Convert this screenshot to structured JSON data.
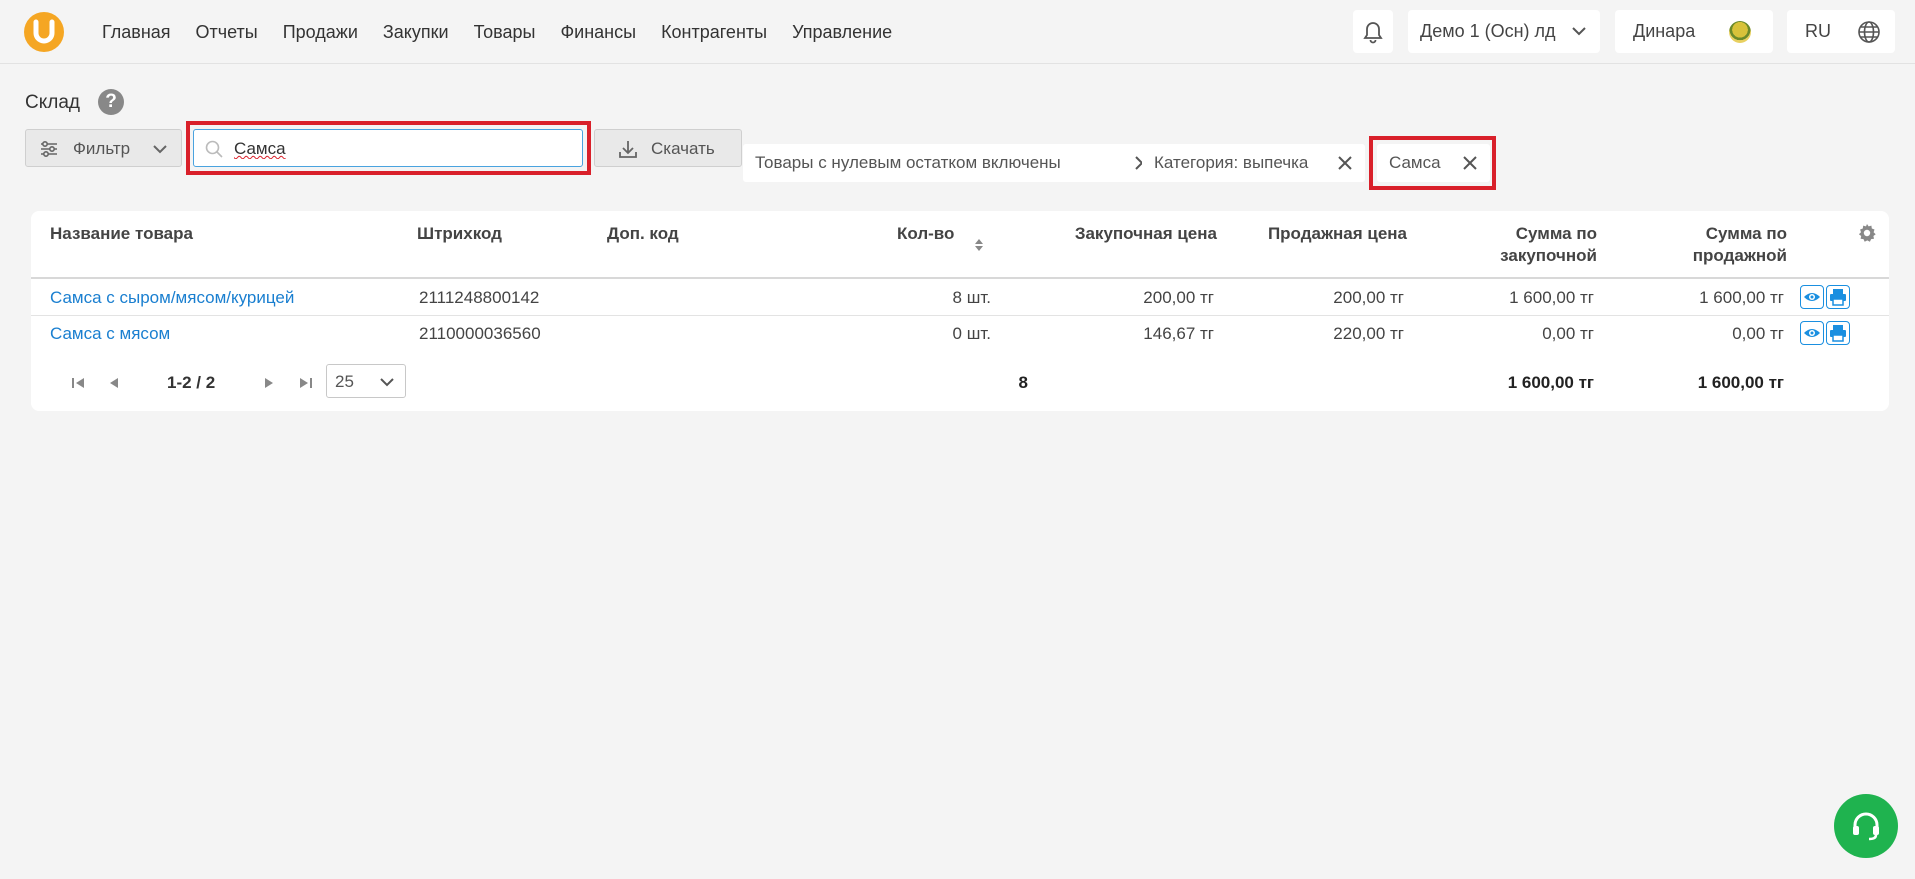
{
  "nav": {
    "items": [
      "Главная",
      "Отчеты",
      "Продажи",
      "Закупки",
      "Товары",
      "Финансы",
      "Контрагенты",
      "Управление"
    ]
  },
  "topbar": {
    "org": "Демо 1 (Осн) лд",
    "user": "Динара",
    "lang": "RU"
  },
  "page": {
    "title": "Склад"
  },
  "toolbar": {
    "filter_label": "Фильтр",
    "search_value": "Самса",
    "download_label": "Скачать"
  },
  "chips": [
    {
      "label": "Товары с нулевым остатком включены"
    },
    {
      "label": "Категория: выпечка"
    },
    {
      "label": "Самса"
    }
  ],
  "table": {
    "headers": {
      "name": "Название товара",
      "barcode": "Штрихкод",
      "extra_code": "Доп. код",
      "qty": "Кол-во",
      "purchase_price": "Закупочная цена",
      "sale_price": "Продажная цена",
      "sum_purchase_1": "Сумма по",
      "sum_purchase_2": "закупочной",
      "sum_sale_1": "Сумма по",
      "sum_sale_2": "продажной"
    },
    "rows": [
      {
        "name": "Самса с сыром/мясом/курицей",
        "barcode": "2111248800142",
        "extra_code": "",
        "qty": "8 шт.",
        "purchase_price": "200,00 тг",
        "sale_price": "200,00 тг",
        "sum_purchase": "1 600,00 тг",
        "sum_sale": "1 600,00 тг"
      },
      {
        "name": "Самса с мясом",
        "barcode": "2110000036560",
        "extra_code": "",
        "qty": "0 шт.",
        "purchase_price": "146,67 тг",
        "sale_price": "220,00 тг",
        "sum_purchase": "0,00 тг",
        "sum_sale": "0,00 тг"
      }
    ],
    "pagination": {
      "range": "1-2 / 2",
      "per_page": "25"
    },
    "totals": {
      "qty": "8",
      "sum_purchase": "1 600,00 тг",
      "sum_sale": "1 600,00 тг"
    }
  },
  "colors": {
    "accent_link": "#1a7fd0",
    "highlight": "#d9202a",
    "support": "#1fb34f",
    "logo": "#f5a623"
  }
}
